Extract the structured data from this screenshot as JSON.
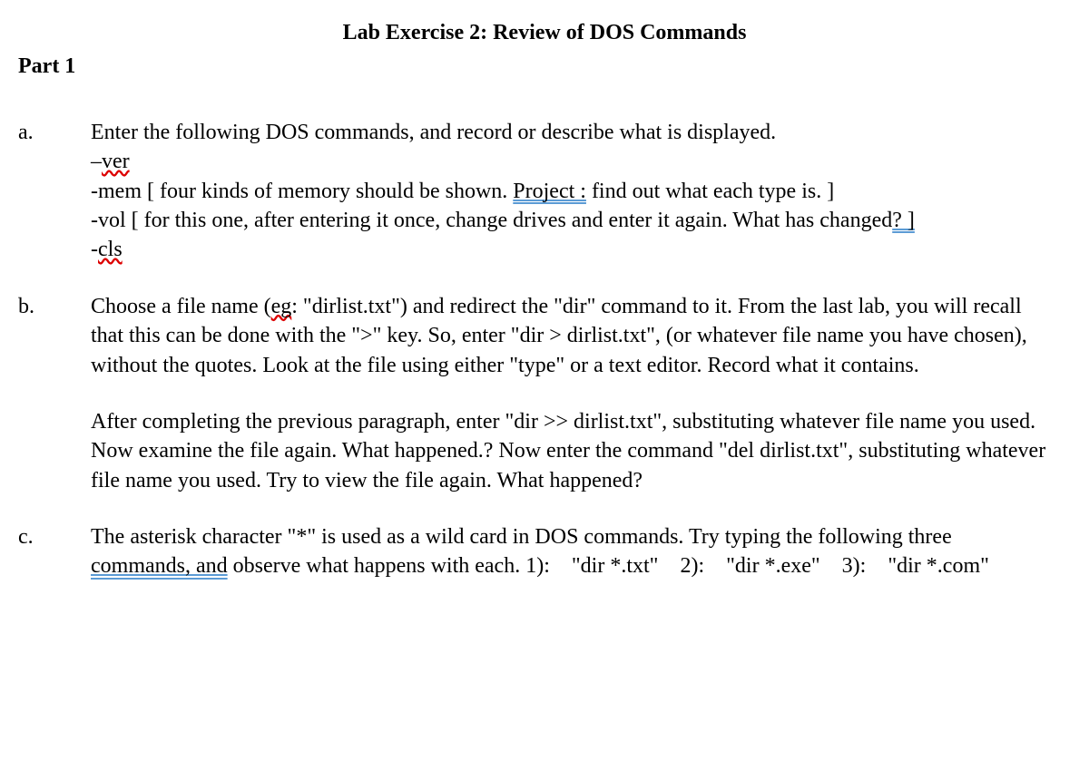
{
  "title": "Lab Exercise 2: Review of DOS Commands",
  "part": "Part 1",
  "items": {
    "a": {
      "bullet": "a.",
      "intro": "Enter the following DOS commands, and record or describe what is displayed.",
      "ver_dash": "–",
      "ver_word": "ver",
      "mem_pre": "-mem [ four kinds of memory should be shown. ",
      "mem_project": "Project :",
      "mem_post": " find out what each type is. ]",
      "vol_pre": "-vol [ for this one, after entering it once, change drives and enter it again. What has changed",
      "vol_mark": "? ]",
      "cls_dash": " -",
      "cls_word": "cls"
    },
    "b": {
      "bullet": "b.",
      "p1_pre": "Choose a file name (",
      "p1_eg": "eg",
      "p1_post": ": \"dirlist.txt\") and redirect the \"dir\" command to it. From the last lab, you will recall that this can be done with the \">\" key. So, enter \"dir > dirlist.txt\", (or whatever file name you have chosen), without the quotes. Look at the file using either \"type\" or a text editor. Record what it contains.",
      "p2": "After completing the previous paragraph, enter \"dir >> dirlist.txt\", substituting whatever file name you used. Now examine the file again. What happened.? Now enter the command \"del dirlist.txt\", substituting whatever file name you used. Try to view the file again. What happened?"
    },
    "c": {
      "bullet": "c.",
      "p1_pre": "The asterisk character \"*\" is used as a wild card in DOS commands. Try typing the following three ",
      "p1_mid": "commands, and",
      "p1_post": " observe what happens with each. 1):    \"dir *.txt\"    2):    \"dir *.exe\"    3):    \"dir *.com\""
    }
  }
}
